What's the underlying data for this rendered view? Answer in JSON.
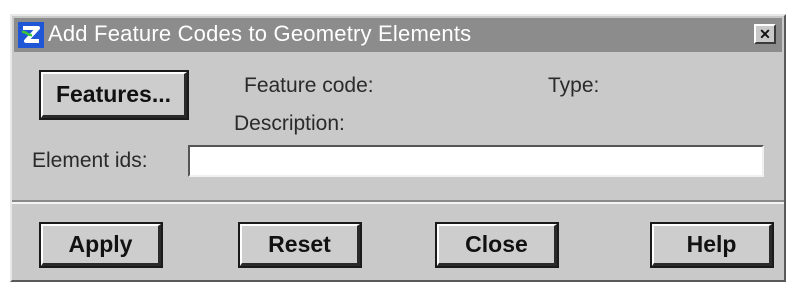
{
  "window": {
    "title": "Add Feature Codes to Geometry Elements",
    "close_glyph": "✕",
    "icon": "app-logo-icon",
    "colors": {
      "titlebar": "#8c8c8c",
      "face": "#c9c9c9"
    }
  },
  "form": {
    "features_button": "Features...",
    "feature_code_label": "Feature code:",
    "type_label": "Type:",
    "description_label": "Description:",
    "element_ids_label": "Element ids:",
    "element_ids_value": ""
  },
  "actions": {
    "apply": "Apply",
    "reset": "Reset",
    "close": "Close",
    "help": "Help"
  }
}
